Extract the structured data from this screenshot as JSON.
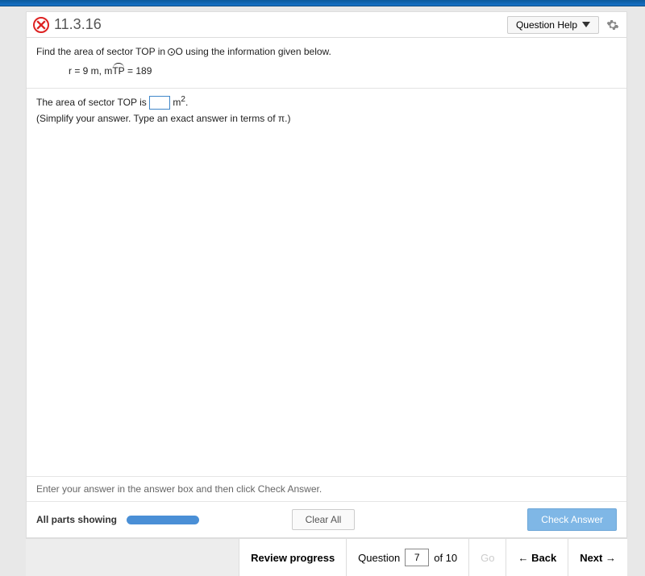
{
  "header": {
    "question_number": "11.3.16",
    "help_label": "Question Help"
  },
  "problem": {
    "prompt_pre": "Find the area of sector TOP in ",
    "prompt_post": "O using the information given below.",
    "given_pre": "r = 9 m, m",
    "arc_label": "TP",
    "given_post": " = 189",
    "answer_pre": "The area of sector TOP is ",
    "answer_unit": " m",
    "hint": "(Simplify your answer. Type an exact answer in terms of π.)"
  },
  "footer": {
    "instruction": "Enter your answer in the answer box and then click Check Answer.",
    "parts_label": "All parts showing",
    "clear_all": "Clear All",
    "check_answer": "Check Answer"
  },
  "nav": {
    "review": "Review progress",
    "question_word": "Question",
    "current": "7",
    "of_total": "of 10",
    "go": "Go",
    "back": "Back",
    "next": "Next"
  }
}
